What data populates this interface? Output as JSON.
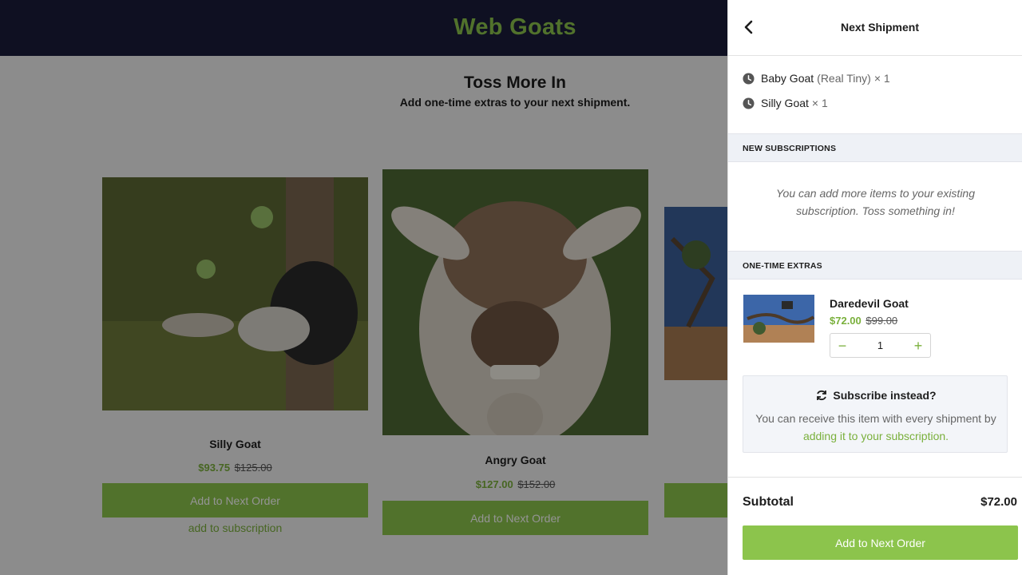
{
  "header": {
    "brand": "Web Goats"
  },
  "page": {
    "title": "Toss More In",
    "subtitle": "Add one-time extras to your next shipment."
  },
  "products": [
    {
      "name": "Silly Goat",
      "price": "$93.75",
      "compare_price": "$125.00",
      "button": "Add to Next Order",
      "sub_link": "add to subscription"
    },
    {
      "name": "Angry Goat",
      "price": "$127.00",
      "compare_price": "$152.00",
      "button": "Add to Next Order"
    },
    {
      "name": "Daredevil Goat"
    }
  ],
  "drawer": {
    "title": "Next Shipment",
    "shipment_items": [
      {
        "name": "Baby Goat",
        "variant": "(Real Tiny)",
        "qty": "× 1",
        "icon": "clock-icon"
      },
      {
        "name": "Silly Goat",
        "qty": "× 1",
        "icon": "clock-icon"
      }
    ],
    "new_subscriptions": {
      "heading": "NEW SUBSCRIPTIONS",
      "empty_message": "You can add more items to your existing subscription. Toss something in!"
    },
    "one_time_extras": {
      "heading": "ONE-TIME EXTRAS",
      "items": [
        {
          "name": "Daredevil Goat",
          "price": "$72.00",
          "compare_price": "$99.00",
          "quantity": "1",
          "minus": "−",
          "plus": "+"
        }
      ]
    },
    "subscribe_box": {
      "title": "Subscribe instead?",
      "text_before": "You can receive this item with every shipment by ",
      "link": "adding it to your subscription."
    },
    "subtotal_label": "Subtotal",
    "subtotal_value": "$72.00",
    "checkout_button": "Add to Next Order"
  },
  "colors": {
    "brand_green": "#8cc44c",
    "header_navy": "#1a1d3b",
    "section_bar": "#eef1f6"
  }
}
